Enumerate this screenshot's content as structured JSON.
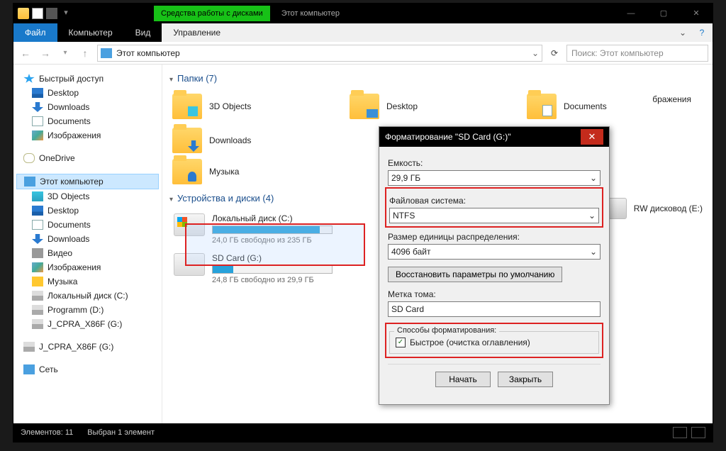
{
  "titlebar": {
    "tools_tab": "Средства работы с дисками",
    "window_title": "Этот компьютер"
  },
  "ribbon": {
    "file": "Файл",
    "tab_computer": "Компьютер",
    "tab_view": "Вид",
    "tab_manage": "Управление"
  },
  "address": {
    "path": "Этот компьютер"
  },
  "search": {
    "placeholder": "Поиск: Этот компьютер"
  },
  "sidebar": {
    "quick_access": "Быстрый доступ",
    "desktop": "Desktop",
    "downloads": "Downloads",
    "documents": "Documents",
    "images": "Изображения",
    "onedrive": "OneDrive",
    "this_pc": "Этот компьютер",
    "obj3d": "3D Objects",
    "desktop2": "Desktop",
    "documents2": "Documents",
    "downloads2": "Downloads",
    "video": "Видео",
    "images2": "Изображения",
    "music": "Музыка",
    "localdisk_c": "Локальный диск (C:)",
    "programm_d": "Programm (D:)",
    "jcpra_g": "J_CPRA_X86F (G:)",
    "jcpra_g2": "J_CPRA_X86F (G:)",
    "network": "Сеть"
  },
  "content": {
    "folders_header": "Папки (7)",
    "devices_header": "Устройства и диски (4)",
    "folders": {
      "obj3d": "3D Objects",
      "desktop": "Desktop",
      "documents": "Documents",
      "downloads": "Downloads",
      "music": "Музыка",
      "images_stray": "бражения"
    },
    "drive_c": {
      "name": "Локальный диск (C:)",
      "free": "24,0 ГБ свободно из 235 ГБ",
      "fill_pct": 90
    },
    "drive_g": {
      "name": "SD Card (G:)",
      "free": "24,8 ГБ свободно из 29,9 ГБ",
      "fill_pct": 17
    },
    "drive_rw": "RW дисковод (E:)"
  },
  "dialog": {
    "title": "Форматирование \"SD Card (G:)\"",
    "capacity_label": "Емкость:",
    "capacity_value": "29,9 ГБ",
    "fs_label": "Файловая система:",
    "fs_value": "NTFS",
    "alloc_label": "Размер единицы распределения:",
    "alloc_value": "4096 байт",
    "restore_btn": "Восстановить параметры по умолчанию",
    "volume_label": "Метка тома:",
    "volume_value": "SD Card",
    "methods_label": "Способы форматирования:",
    "quick_label": "Быстрое (очистка оглавления)",
    "start": "Начать",
    "close": "Закрыть"
  },
  "status": {
    "items": "Элементов: 11",
    "selected": "Выбран 1 элемент"
  }
}
